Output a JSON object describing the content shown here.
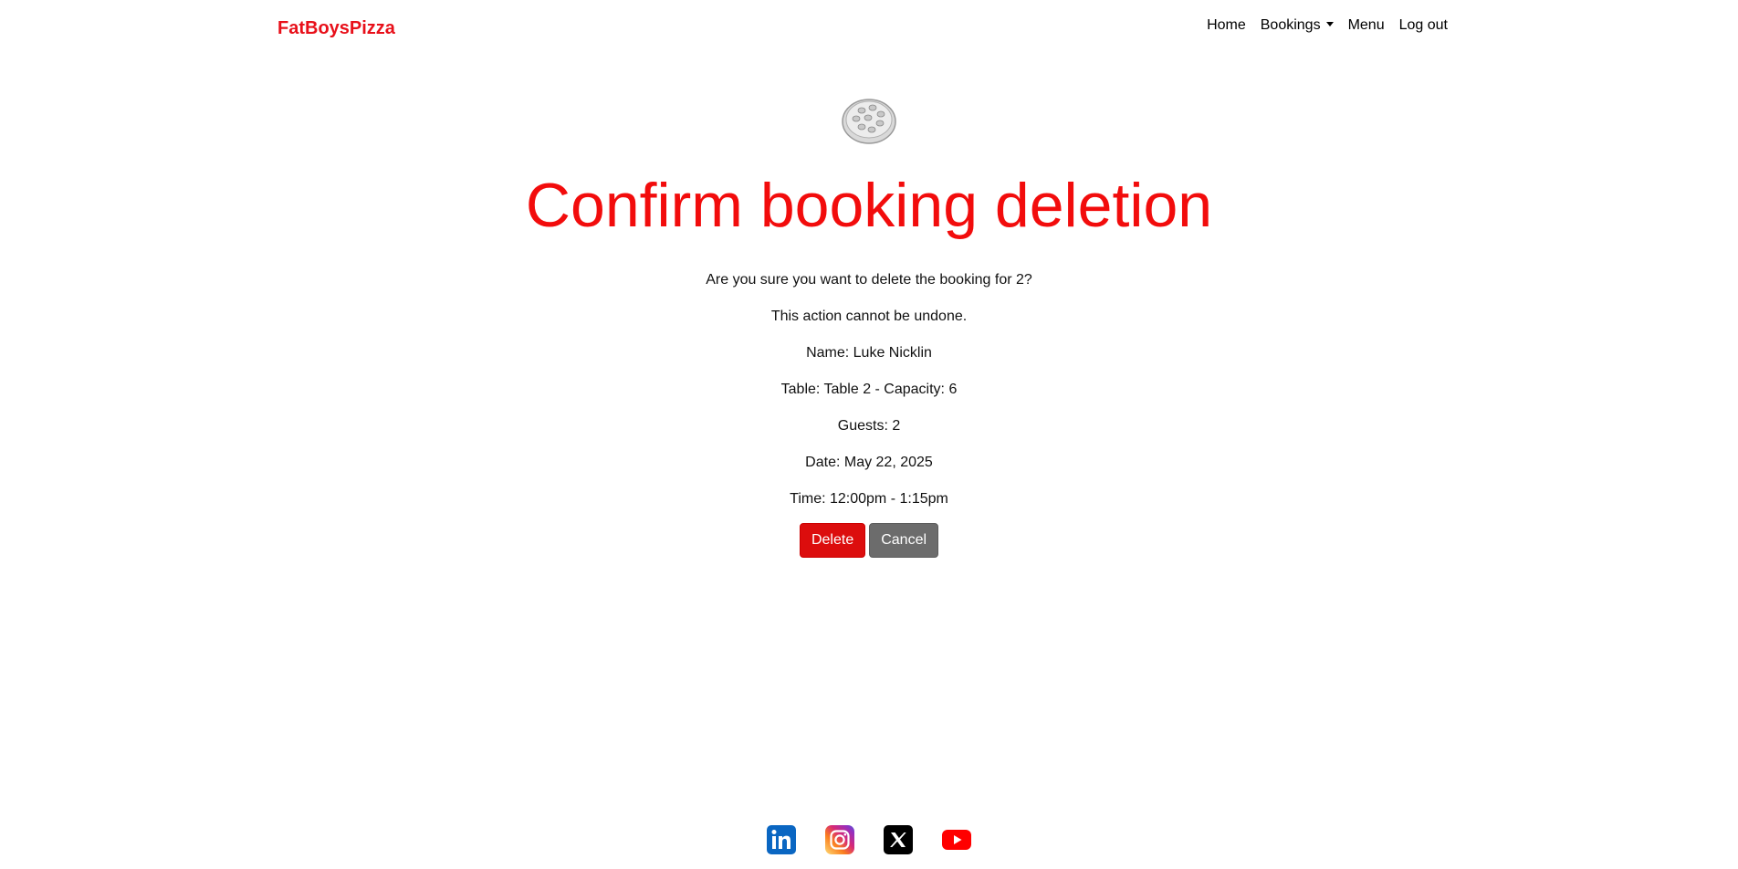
{
  "nav": {
    "brand": "FatBoysPizza",
    "links": [
      "Home",
      "Bookings",
      "Menu",
      "Log out"
    ]
  },
  "page": {
    "title": "Confirm booking deletion",
    "question": "Are you sure you want to delete the booking for 2?",
    "warning": "This action cannot be undone.",
    "name": "Name: Luke Nicklin",
    "table": "Table: Table 2 - Capacity: 6",
    "guests": "Guests: 2",
    "date": "Date: May 22, 2025",
    "time": "Time: 12:00pm - 1:15pm"
  },
  "actions": {
    "delete_label": "Delete",
    "cancel_label": "Cancel"
  },
  "footer": {
    "icons": [
      "linkedin-icon",
      "instagram-icon",
      "x-icon",
      "youtube-icon"
    ]
  },
  "colors": {
    "brand": "#e8101a",
    "title": "#f20c0c",
    "delete": "#dc0d0d",
    "cancel": "#6c6c6c"
  }
}
